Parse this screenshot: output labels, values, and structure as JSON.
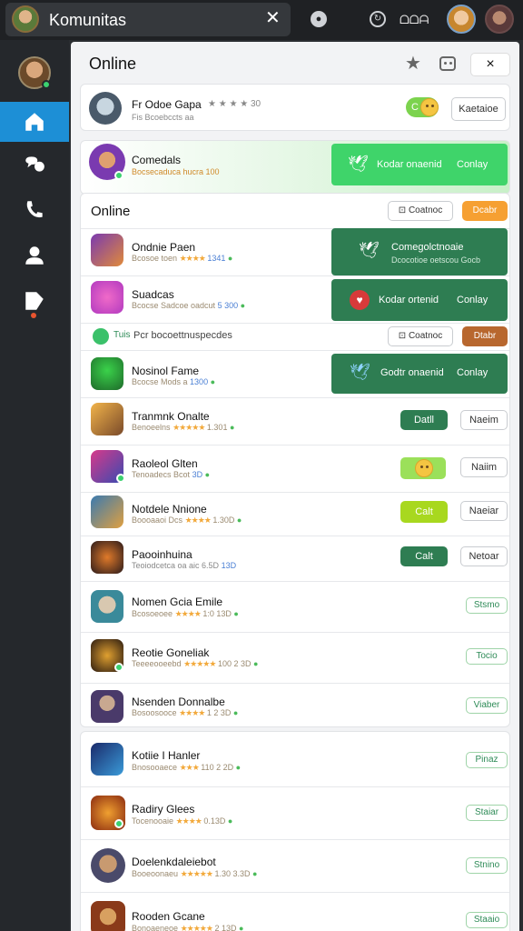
{
  "app": {
    "title": "Komunitas",
    "top_text": "ᗝᗝᗩ"
  },
  "panel": {
    "title": "Online",
    "close_label": "×"
  },
  "profile_card": {
    "name": "Fr Odoe Gapa",
    "rating": "★ ★ ★ ★ 30",
    "sub": "Fis Bcoebccts aa",
    "button_label": "Kaetaioe",
    "pill_label": "C"
  },
  "featured": {
    "name": "Comedals",
    "sub": "Bocsecaduca hucra 100",
    "banner_label": "Kodar onaenid",
    "banner_action": "Conlay"
  },
  "online_section": {
    "title": "Online",
    "filter_label": "Coatnoc",
    "filter_button": "Dcabr"
  },
  "online_items": [
    {
      "name": "Ondnie Paen",
      "sub": "Bcosoe toen",
      "rating": "★★★★",
      "meta": "1341",
      "banner_title": "Comegolctnoaie",
      "banner_sub": "Dcocotioe oetscou Gocb"
    },
    {
      "name": "Suadcas",
      "sub": "Bcocse Sadcoe oadcut",
      "meta": "5 300",
      "banner_label": "Kodar ortenid",
      "banner_action": "Conlay"
    },
    {
      "name": "Pcr bocoettnuspecdes",
      "prefix": "Tuis",
      "filter_label": "Coatnoc",
      "filter_button": "Dtabr"
    },
    {
      "name": "Nosinol Fame",
      "sub": "Bcocse Mods a",
      "meta": "1300",
      "banner_label": "Godtr onaenid",
      "banner_action": "Conlay"
    }
  ],
  "friends": [
    {
      "name": "Tranmnk Onalte",
      "sub": "Benoeelns",
      "meta": "1.301",
      "button1": "Datll",
      "button2": "Naeim"
    },
    {
      "name": "Raoleol Glten",
      "sub": "Tenoadecs Bcot",
      "meta": "3D",
      "button2": "Naiim"
    },
    {
      "name": "Notdele Nnione",
      "sub": "Boooaaoi Dcs",
      "meta": "1.30D",
      "button1": "Calt",
      "button2": "Naeiar"
    },
    {
      "name": "Paooinhuina",
      "sub": "Teoiodcetca oa aic 6.5D",
      "meta": "13D",
      "button1": "Calt",
      "button2": "Netoar"
    }
  ],
  "list": [
    {
      "name": "Nomen Gcia Emile",
      "sub": "Bcosoeoee",
      "meta": "1:0 13D",
      "button": "Stsmo"
    },
    {
      "name": "Reotie Goneliak",
      "sub": "Teeeeooeebd",
      "meta": "100 2 3D",
      "button": "Tocio"
    },
    {
      "name": "Nsenden Donnalbe",
      "sub": "Bosoosooce",
      "meta": "1 2 3D",
      "button": "Viaber"
    },
    {
      "name": "Kotiie I Hanler",
      "sub": "Bnosooaece",
      "meta": "110 2 2D",
      "button": "Pinaz"
    },
    {
      "name": "Radiry Glees",
      "sub": "Tocenooaie",
      "meta": "0.13D",
      "button": "Staiar"
    },
    {
      "name": "Doelenkdaleiebot",
      "sub": "Booeoonaeu",
      "meta": "1.30 3.3D",
      "button": "Stnino"
    },
    {
      "name": "Rooden Gcane",
      "sub": "Bonoaeneoe",
      "meta": "2 13D",
      "button": "Staaio"
    }
  ]
}
